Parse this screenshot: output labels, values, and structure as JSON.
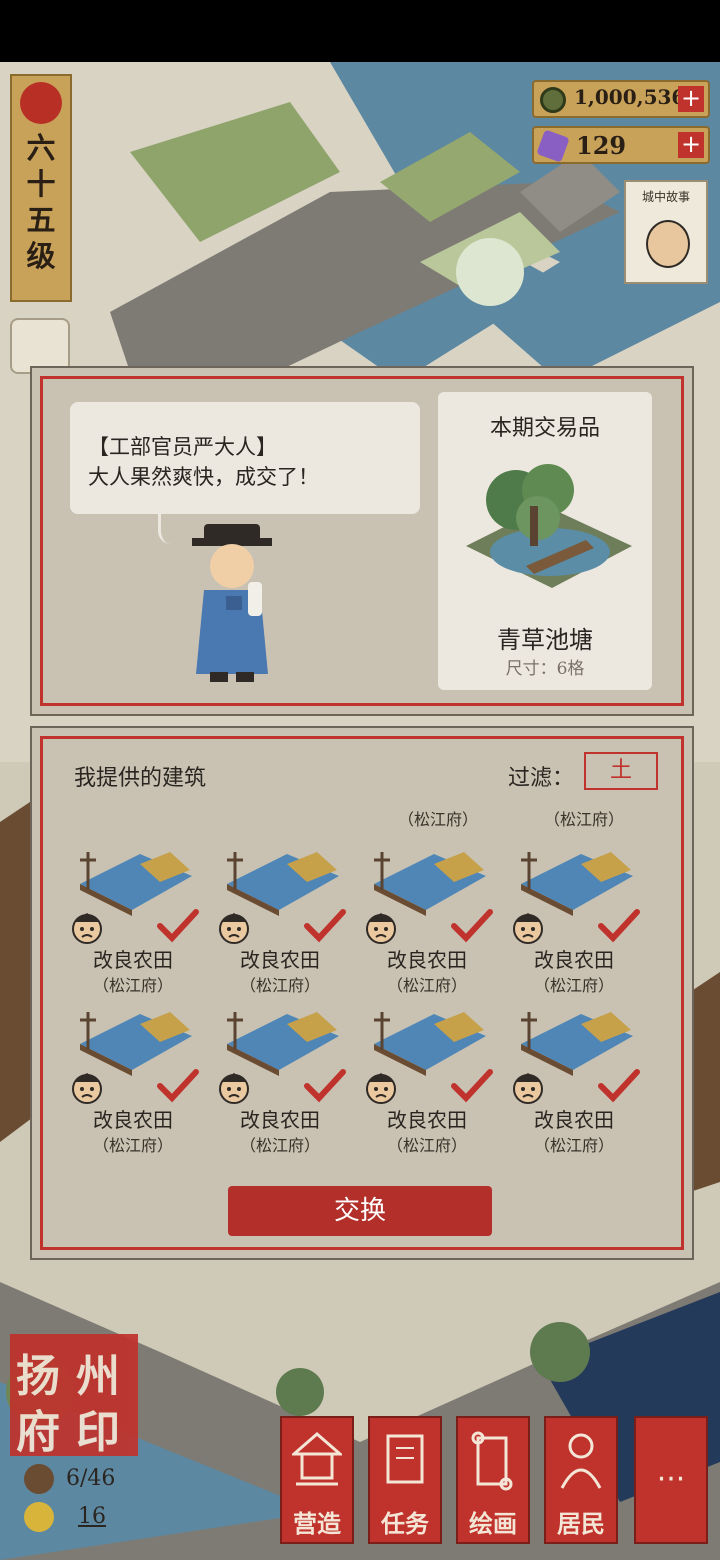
{
  "hud": {
    "level_text": "六\n十\n五\n级",
    "copper": "1,000,536",
    "copper_plus": "+",
    "jade": "129",
    "jade_plus": "+",
    "story_label": "城中故事"
  },
  "trade_panel": {
    "speaker": "【工部官员严大人】",
    "dialogue": "大人果然爽快，成交了！",
    "offer_title": "本期交易品",
    "offer_name": "青草池塘",
    "offer_size": "尺寸：6格"
  },
  "buildings_panel": {
    "title": "我提供的建筑",
    "filter_label": "过滤：",
    "filter_value": "土",
    "orphan_regions": [
      "（松江府）",
      "（松江府）"
    ],
    "items": [
      {
        "name": "改良农田",
        "region": "（松江府）"
      },
      {
        "name": "改良农田",
        "region": "（松江府）"
      },
      {
        "name": "改良农田",
        "region": "（松江府）"
      },
      {
        "name": "改良农田",
        "region": "（松江府）"
      },
      {
        "name": "改良农田",
        "region": "（松江府）"
      },
      {
        "name": "改良农田",
        "region": "（松江府）"
      },
      {
        "name": "改良农田",
        "region": "（松江府）"
      },
      {
        "name": "改良农田",
        "region": "（松江府）"
      }
    ],
    "swap_button": "交换"
  },
  "bottom": {
    "city_seal": [
      "扬",
      "州",
      "府",
      "印"
    ],
    "residents": "6/46",
    "coins": "16",
    "nav": [
      {
        "label": "营造",
        "icon": "pavilion-icon"
      },
      {
        "label": "任务",
        "icon": "book-icon"
      },
      {
        "label": "绘画",
        "icon": "scroll-icon"
      },
      {
        "label": "居民",
        "icon": "person-icon"
      }
    ],
    "more": "···"
  },
  "colors": {
    "accent_red": "#c0322c",
    "paper": "#c9c2b3",
    "gold": "#c9a25a"
  }
}
